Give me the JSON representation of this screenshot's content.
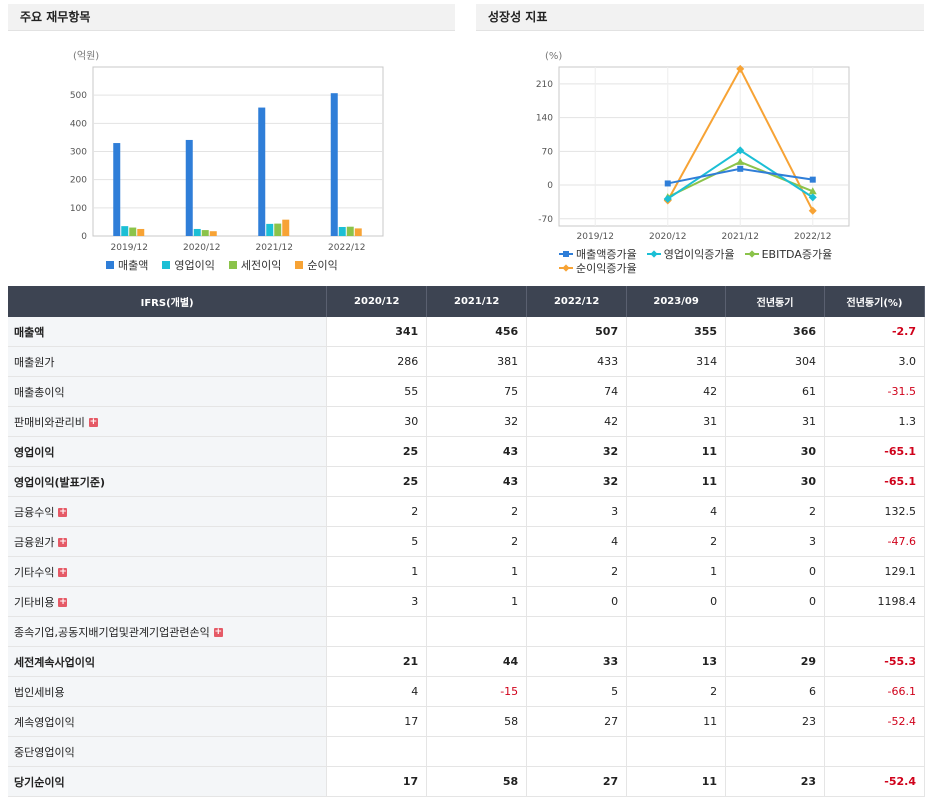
{
  "left_panel": {
    "title": "주요 재무항목",
    "colors": [
      "#2f7ed8",
      "#1bbfd5",
      "#8bc34a",
      "#f7a335"
    ]
  },
  "right_panel": {
    "title": "성장성 지표",
    "colors": [
      "#2f7ed8",
      "#1bbfd5",
      "#8bc34a",
      "#f7a335"
    ]
  },
  "chart_data": [
    {
      "type": "bar",
      "unit": "(억원)",
      "categories": [
        "2019/12",
        "2020/12",
        "2021/12",
        "2022/12"
      ],
      "ylim": [
        0,
        600
      ],
      "yticks": [
        "0",
        "100",
        "200",
        "300",
        "400",
        "500"
      ],
      "series": [
        {
          "name": "매출액",
          "values": [
            330,
            341,
            456,
            507
          ]
        },
        {
          "name": "영업이익",
          "values": [
            35,
            25,
            43,
            32
          ]
        },
        {
          "name": "세전이익",
          "values": [
            30,
            21,
            44,
            33
          ]
        },
        {
          "name": "순이익",
          "values": [
            25,
            17,
            58,
            27
          ]
        }
      ],
      "grid": true,
      "legend": "bottom"
    },
    {
      "type": "line",
      "unit": "(%)",
      "categories": [
        "2019/12",
        "2020/12",
        "2021/12",
        "2022/12"
      ],
      "ylim": [
        -85,
        245
      ],
      "yticks": [
        "-70",
        "0",
        "70",
        "140",
        "210"
      ],
      "series": [
        {
          "name": "매출액증가율",
          "values": [
            null,
            3.3,
            33.7,
            11.2
          ]
        },
        {
          "name": "영업이익증가율",
          "values": [
            null,
            -28.6,
            72.0,
            -25.6
          ]
        },
        {
          "name": "EBITDA증가율",
          "values": [
            null,
            -25.0,
            48.0,
            -13.0
          ]
        },
        {
          "name": "순이익증가율",
          "values": [
            null,
            -32.0,
            241.2,
            -53.4
          ]
        }
      ],
      "grid": true,
      "legend": "bottom"
    }
  ],
  "table": {
    "headers": [
      "IFRS(개별)",
      "2020/12",
      "2021/12",
      "2022/12",
      "2023/09",
      "전년동기",
      "전년동기(%)"
    ],
    "rows": [
      {
        "label": "매출액",
        "bold": true,
        "plus": false,
        "values": [
          "341",
          "456",
          "507",
          "355",
          "366",
          "-2.7"
        ]
      },
      {
        "label": "매출원가",
        "bold": false,
        "plus": false,
        "values": [
          "286",
          "381",
          "433",
          "314",
          "304",
          "3.0"
        ]
      },
      {
        "label": "매출총이익",
        "bold": false,
        "plus": false,
        "values": [
          "55",
          "75",
          "74",
          "42",
          "61",
          "-31.5"
        ]
      },
      {
        "label": "판매비와관리비",
        "bold": false,
        "plus": true,
        "values": [
          "30",
          "32",
          "42",
          "31",
          "31",
          "1.3"
        ]
      },
      {
        "label": "영업이익",
        "bold": true,
        "plus": false,
        "values": [
          "25",
          "43",
          "32",
          "11",
          "30",
          "-65.1"
        ]
      },
      {
        "label": "영업이익(발표기준)",
        "bold": true,
        "plus": false,
        "values": [
          "25",
          "43",
          "32",
          "11",
          "30",
          "-65.1"
        ]
      },
      {
        "label": "금융수익",
        "bold": false,
        "plus": true,
        "values": [
          "2",
          "2",
          "3",
          "4",
          "2",
          "132.5"
        ]
      },
      {
        "label": "금융원가",
        "bold": false,
        "plus": true,
        "values": [
          "5",
          "2",
          "4",
          "2",
          "3",
          "-47.6"
        ]
      },
      {
        "label": "기타수익",
        "bold": false,
        "plus": true,
        "values": [
          "1",
          "1",
          "2",
          "1",
          "0",
          "129.1"
        ]
      },
      {
        "label": "기타비용",
        "bold": false,
        "plus": true,
        "values": [
          "3",
          "1",
          "0",
          "0",
          "0",
          "1198.4"
        ]
      },
      {
        "label": "종속기업,공동지배기업및관계기업관련손익",
        "bold": false,
        "plus": true,
        "values": [
          "",
          "",
          "",
          "",
          "",
          ""
        ]
      },
      {
        "label": "세전계속사업이익",
        "bold": true,
        "plus": false,
        "values": [
          "21",
          "44",
          "33",
          "13",
          "29",
          "-55.3"
        ]
      },
      {
        "label": "법인세비용",
        "bold": false,
        "plus": false,
        "values": [
          "4",
          "-15",
          "5",
          "2",
          "6",
          "-66.1"
        ]
      },
      {
        "label": "계속영업이익",
        "bold": false,
        "plus": false,
        "values": [
          "17",
          "58",
          "27",
          "11",
          "23",
          "-52.4"
        ]
      },
      {
        "label": "중단영업이익",
        "bold": false,
        "plus": false,
        "values": [
          "",
          "",
          "",
          "",
          "",
          ""
        ]
      },
      {
        "label": "당기순이익",
        "bold": true,
        "plus": false,
        "values": [
          "17",
          "58",
          "27",
          "11",
          "23",
          "-52.4"
        ]
      }
    ]
  }
}
